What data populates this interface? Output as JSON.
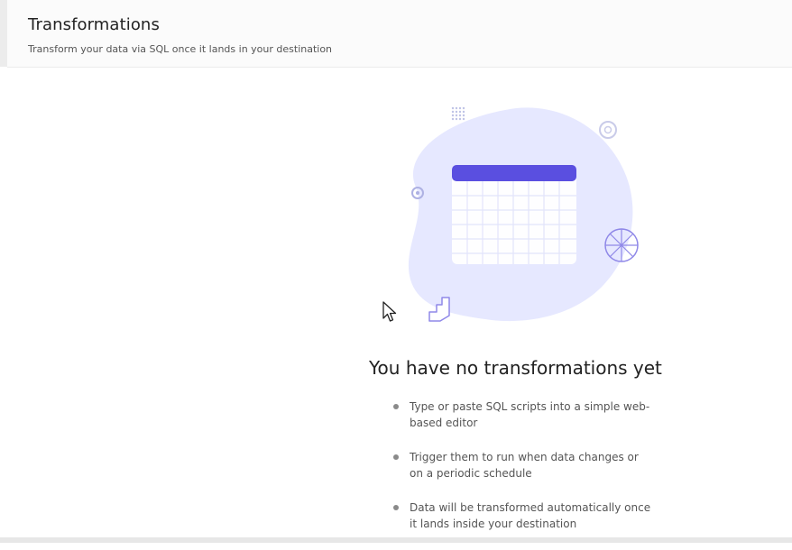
{
  "header": {
    "title": "Transformations",
    "subtitle": "Transform your data via SQL once it lands in your destination"
  },
  "empty_state": {
    "illustration": "calendar-blob-illustration",
    "title": "You have no transformations yet",
    "bullets": [
      "Type or paste SQL scripts into a simple web-based editor",
      "Trigger them to run when data changes or on a periodic schedule",
      "Data will be transformed automatically once it lands inside your destination"
    ]
  },
  "colors": {
    "blob": "#e6e8ff",
    "calendar_header": "#5a4fe0",
    "calendar_grid": "#ffffff",
    "accent_line": "#8f88e8"
  }
}
